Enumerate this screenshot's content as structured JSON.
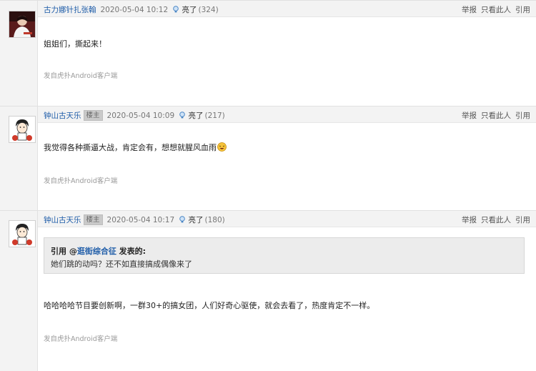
{
  "actions": {
    "report": "举报",
    "only_this": "只看此人",
    "quote": "引用"
  },
  "posts": [
    {
      "user": "古力娜针扎张翰",
      "badge": "",
      "time": "2020-05-04 10:12",
      "light_label": "亮了",
      "light_count": "(324)",
      "content": "姐姐们，撕起来！",
      "source": "发自虎扑Android客户端"
    },
    {
      "user": "钟山古天乐",
      "badge": "楼主",
      "time": "2020-05-04 10:09",
      "light_label": "亮了",
      "light_count": "(217)",
      "content": "我觉得各种撕逼大战，肯定会有，想想就腥风血雨",
      "source": "发自虎扑Android客户端"
    },
    {
      "user": "钟山古天乐",
      "badge": "楼主",
      "time": "2020-05-04 10:17",
      "light_label": "亮了",
      "light_count": "(180)",
      "quote": {
        "prefix": "引用 @",
        "quoted_user": "逛街综合征",
        "suffix": " 发表的:",
        "text": "她们跳的动吗？还不如直接搞成偶像来了"
      },
      "content": "哈哈哈哈节目要创新啊，一群30+的搞女团，人们好奇心驱使，就会去看了，热度肯定不一样。",
      "source": "发自虎扑Android客户端"
    }
  ]
}
